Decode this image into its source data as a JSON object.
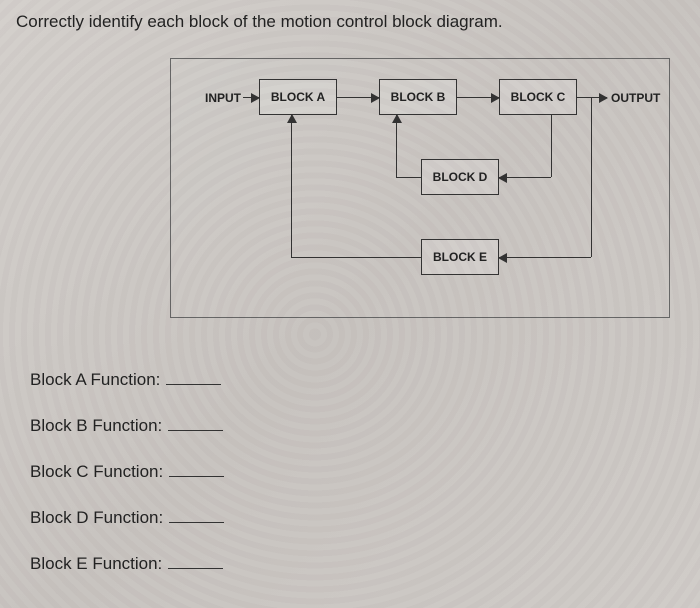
{
  "prompt": "Correctly identify each block of the motion control block diagram.",
  "diagram": {
    "input_label": "INPUT",
    "output_label": "OUTPUT",
    "blocks": {
      "a": "BLOCK A",
      "b": "BLOCK B",
      "c": "BLOCK C",
      "d": "BLOCK D",
      "e": "BLOCK E"
    }
  },
  "answers": {
    "a_label": "Block A Function:",
    "b_label": "Block B Function:",
    "c_label": "Block C Function:",
    "d_label": "Block D Function:",
    "e_label": "Block E Function:",
    "a_value": "",
    "b_value": "",
    "c_value": "",
    "d_value": "",
    "e_value": ""
  }
}
